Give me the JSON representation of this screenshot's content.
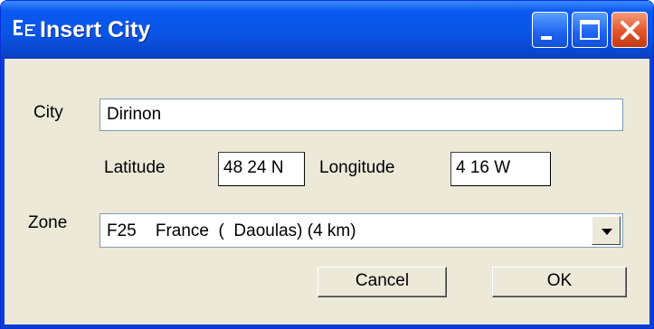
{
  "window": {
    "title": "Insert City",
    "title_icon": "insert-city-app-icon",
    "controls": {
      "minimize": "minimize-icon",
      "maximize": "maximize-icon",
      "close": "close-icon"
    }
  },
  "form": {
    "city_label": "City",
    "city_value": "Dirinon",
    "latitude_label": "Latitude",
    "latitude_value": "48 24 N",
    "longitude_label": "Longitude",
    "longitude_value": "4 16 W",
    "zone_label": "Zone",
    "zone_value": "F25    France  (  Daoulas) (4 km)",
    "zone_dropdown_icon": "dropdown-arrow-icon"
  },
  "buttons": {
    "cancel": "Cancel",
    "ok": "OK"
  },
  "colors": {
    "titlebar": "#0a56e6",
    "dialog_bg": "#ece9d8",
    "close_button": "#e3542a"
  }
}
